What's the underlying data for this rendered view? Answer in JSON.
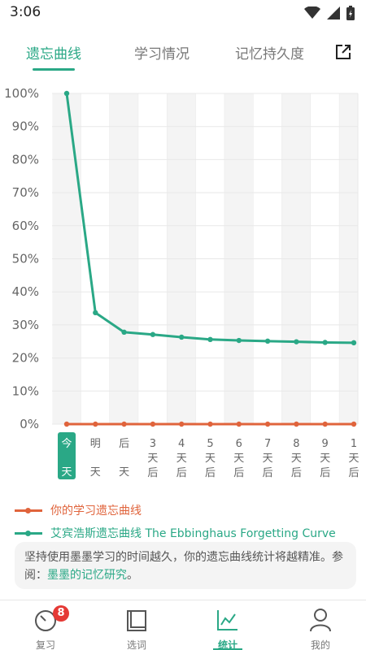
{
  "status_bar": {
    "time": "3:06"
  },
  "tabs": [
    {
      "label": "遗忘曲线",
      "active": true
    },
    {
      "label": "学习情况",
      "active": false
    },
    {
      "label": "记忆持久度",
      "active": false
    }
  ],
  "chart_data": {
    "type": "line",
    "title": "",
    "xlabel": "",
    "ylabel": "",
    "ylim": [
      0,
      100
    ],
    "y_ticks": [
      "0%",
      "10%",
      "20%",
      "30%",
      "40%",
      "50%",
      "60%",
      "70%",
      "80%",
      "90%",
      "100%"
    ],
    "categories": [
      [
        "今",
        "天"
      ],
      [
        "明",
        "天"
      ],
      [
        "后",
        "天"
      ],
      [
        "3",
        "天",
        "后"
      ],
      [
        "4",
        "天",
        "后"
      ],
      [
        "5",
        "天",
        "后"
      ],
      [
        "6",
        "天",
        "后"
      ],
      [
        "7",
        "天",
        "后"
      ],
      [
        "8",
        "天",
        "后"
      ],
      [
        "9",
        "天",
        "后"
      ],
      [
        "1",
        "天",
        "后"
      ]
    ],
    "highlighted_category": 0,
    "series": [
      {
        "name": "你的学习遗忘曲线",
        "color": "#e0643c",
        "values": [
          0,
          0,
          0,
          0,
          0,
          0,
          0,
          0,
          0,
          0,
          0
        ]
      },
      {
        "name": "艾宾浩斯遗忘曲线 The Ebbinghaus Forgetting Curve",
        "color": "#2aa886",
        "values": [
          100,
          33.7,
          27.8,
          27.1,
          26.3,
          25.6,
          25.3,
          25.1,
          24.9,
          24.7,
          24.6
        ]
      }
    ],
    "grid": true
  },
  "legend": {
    "mine": "你的学习遗忘曲线",
    "ebbinghaus": "艾宾浩斯遗忘曲线 The Ebbinghaus Forgetting Curve"
  },
  "note": {
    "text": "坚持使用墨墨学习的时间越久，你的遗忘曲线统计将越精准。参阅：",
    "link": "墨墨的记忆研究",
    "suffix": "。"
  },
  "bottom_nav": [
    {
      "label": "复习",
      "icon": "timer-icon",
      "badge": "8",
      "active": false
    },
    {
      "label": "选词",
      "icon": "book-icon",
      "active": false
    },
    {
      "label": "统计",
      "icon": "chart-icon",
      "active": true
    },
    {
      "label": "我的",
      "icon": "person-icon",
      "active": false
    }
  ],
  "colors": {
    "accent": "#2aa886",
    "mine_series": "#e0643c",
    "badge": "#e53935"
  }
}
